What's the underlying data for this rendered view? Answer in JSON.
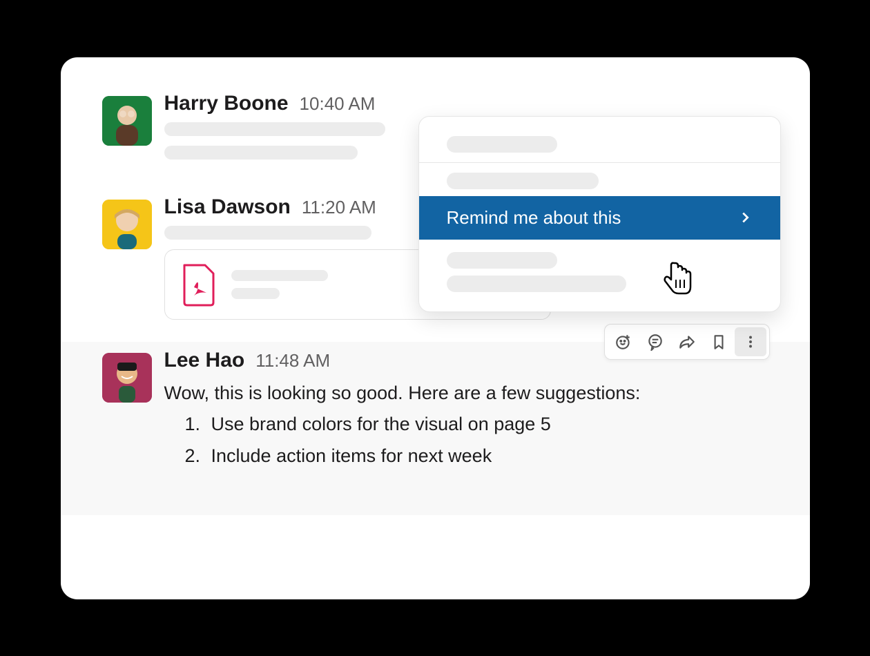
{
  "messages": [
    {
      "author": "Harry Boone",
      "time": "10:40 AM"
    },
    {
      "author": "Lisa Dawson",
      "time": "11:20 AM"
    },
    {
      "author": "Lee Hao",
      "time": "11:48 AM",
      "text": "Wow, this is looking so good. Here are a few suggestions:",
      "list": [
        "Use brand colors for the visual on page 5",
        "Include action items for next week"
      ]
    }
  ],
  "context_menu": {
    "highlighted_item": "Remind me about this"
  },
  "toolbar": {
    "emoji": "add-reaction",
    "thread": "start-thread",
    "share": "share-message",
    "bookmark": "bookmark",
    "more": "more-actions"
  }
}
